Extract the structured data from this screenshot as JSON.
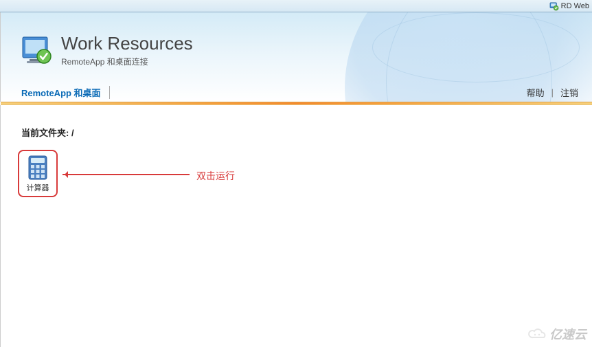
{
  "topbar": {
    "label": "RD Web"
  },
  "header": {
    "title": "Work Resources",
    "subtitle": "RemoteApp 和桌面连接"
  },
  "nav": {
    "tab": "RemoteApp 和桌面",
    "help": "帮助",
    "signout": "注销"
  },
  "content": {
    "folder_label": "当前文件夹: /",
    "app_name": "计算器",
    "annotation": "双击运行"
  },
  "watermark": {
    "text": "亿速云"
  }
}
